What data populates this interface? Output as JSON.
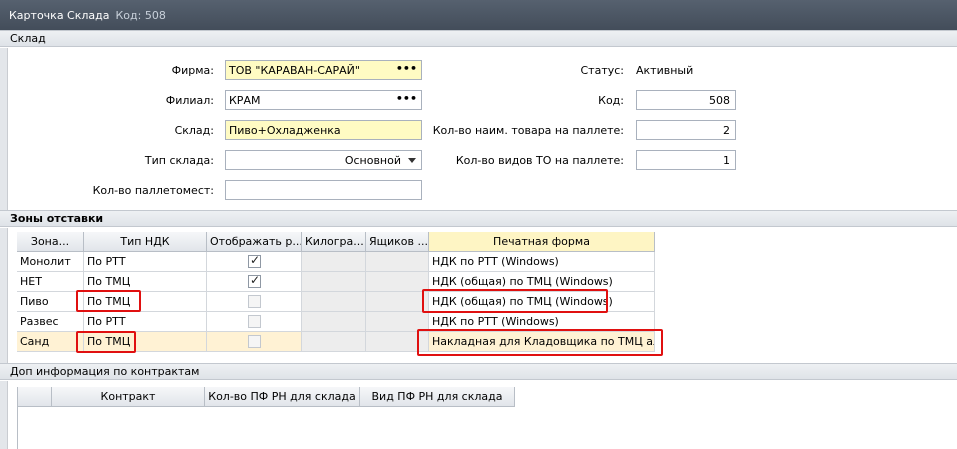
{
  "window": {
    "title": "Карточка Склада",
    "code_label": "Код: 508"
  },
  "sections": {
    "warehouse": "Склад",
    "zones": "Зоны отставки",
    "extra": "Доп информация по контрактам"
  },
  "form": {
    "firm_label": "Фирма:",
    "firm_value": "ТОВ \"КАРАВАН-САРАЙ\"",
    "branch_label": "Филиал:",
    "branch_value": "КРАМ",
    "warehouse_label": "Склад:",
    "warehouse_value": "Пиво+Охладженка",
    "type_label": "Тип склада:",
    "type_value": "Основной",
    "pallet_places_label": "Кол-во паллетомест:",
    "pallet_places_value": "",
    "status_label": "Статус:",
    "status_value": "Активный",
    "code_label": "Код:",
    "code_value": "508",
    "names_per_pallet_label": "Кол-во наим. товара на паллете:",
    "names_per_pallet_value": "2",
    "to_types_label": "Кол-во видов ТО на паллете:",
    "to_types_value": "1",
    "dots": "•••"
  },
  "zones_grid": {
    "headers": [
      "Зона...",
      "Тип НДК",
      "Отображать р...",
      "Килогра...",
      "Ящиков ...",
      "Печатная форма"
    ],
    "rows": [
      {
        "zone": "Монолит",
        "ndk": "По РТТ",
        "show": true,
        "form": "НДК по РТТ (Windows)"
      },
      {
        "zone": "НЕТ",
        "ndk": "По ТМЦ",
        "show": true,
        "form": "НДК (общая) по ТМЦ (Windows)"
      },
      {
        "zone": "Пиво",
        "ndk": "По ТМЦ",
        "show": false,
        "form": "НДК (общая) по ТМЦ (Windows)"
      },
      {
        "zone": "Развес",
        "ndk": "По РТТ",
        "show": false,
        "form": "НДК по РТТ (Windows)"
      },
      {
        "zone": "Санд",
        "ndk": "По ТМЦ",
        "show": false,
        "form": "Накладная для Кладовщика по ТМЦ альб."
      }
    ],
    "selected_row": 4
  },
  "contracts_grid": {
    "headers": [
      "",
      "Контракт",
      "Кол-во ПФ РН для склада",
      "Вид ПФ РН для склада"
    ]
  },
  "colors": {
    "highlight_border": "#e01010",
    "yellow_field": "#fffbc3",
    "titlebar": "#4d5764"
  }
}
